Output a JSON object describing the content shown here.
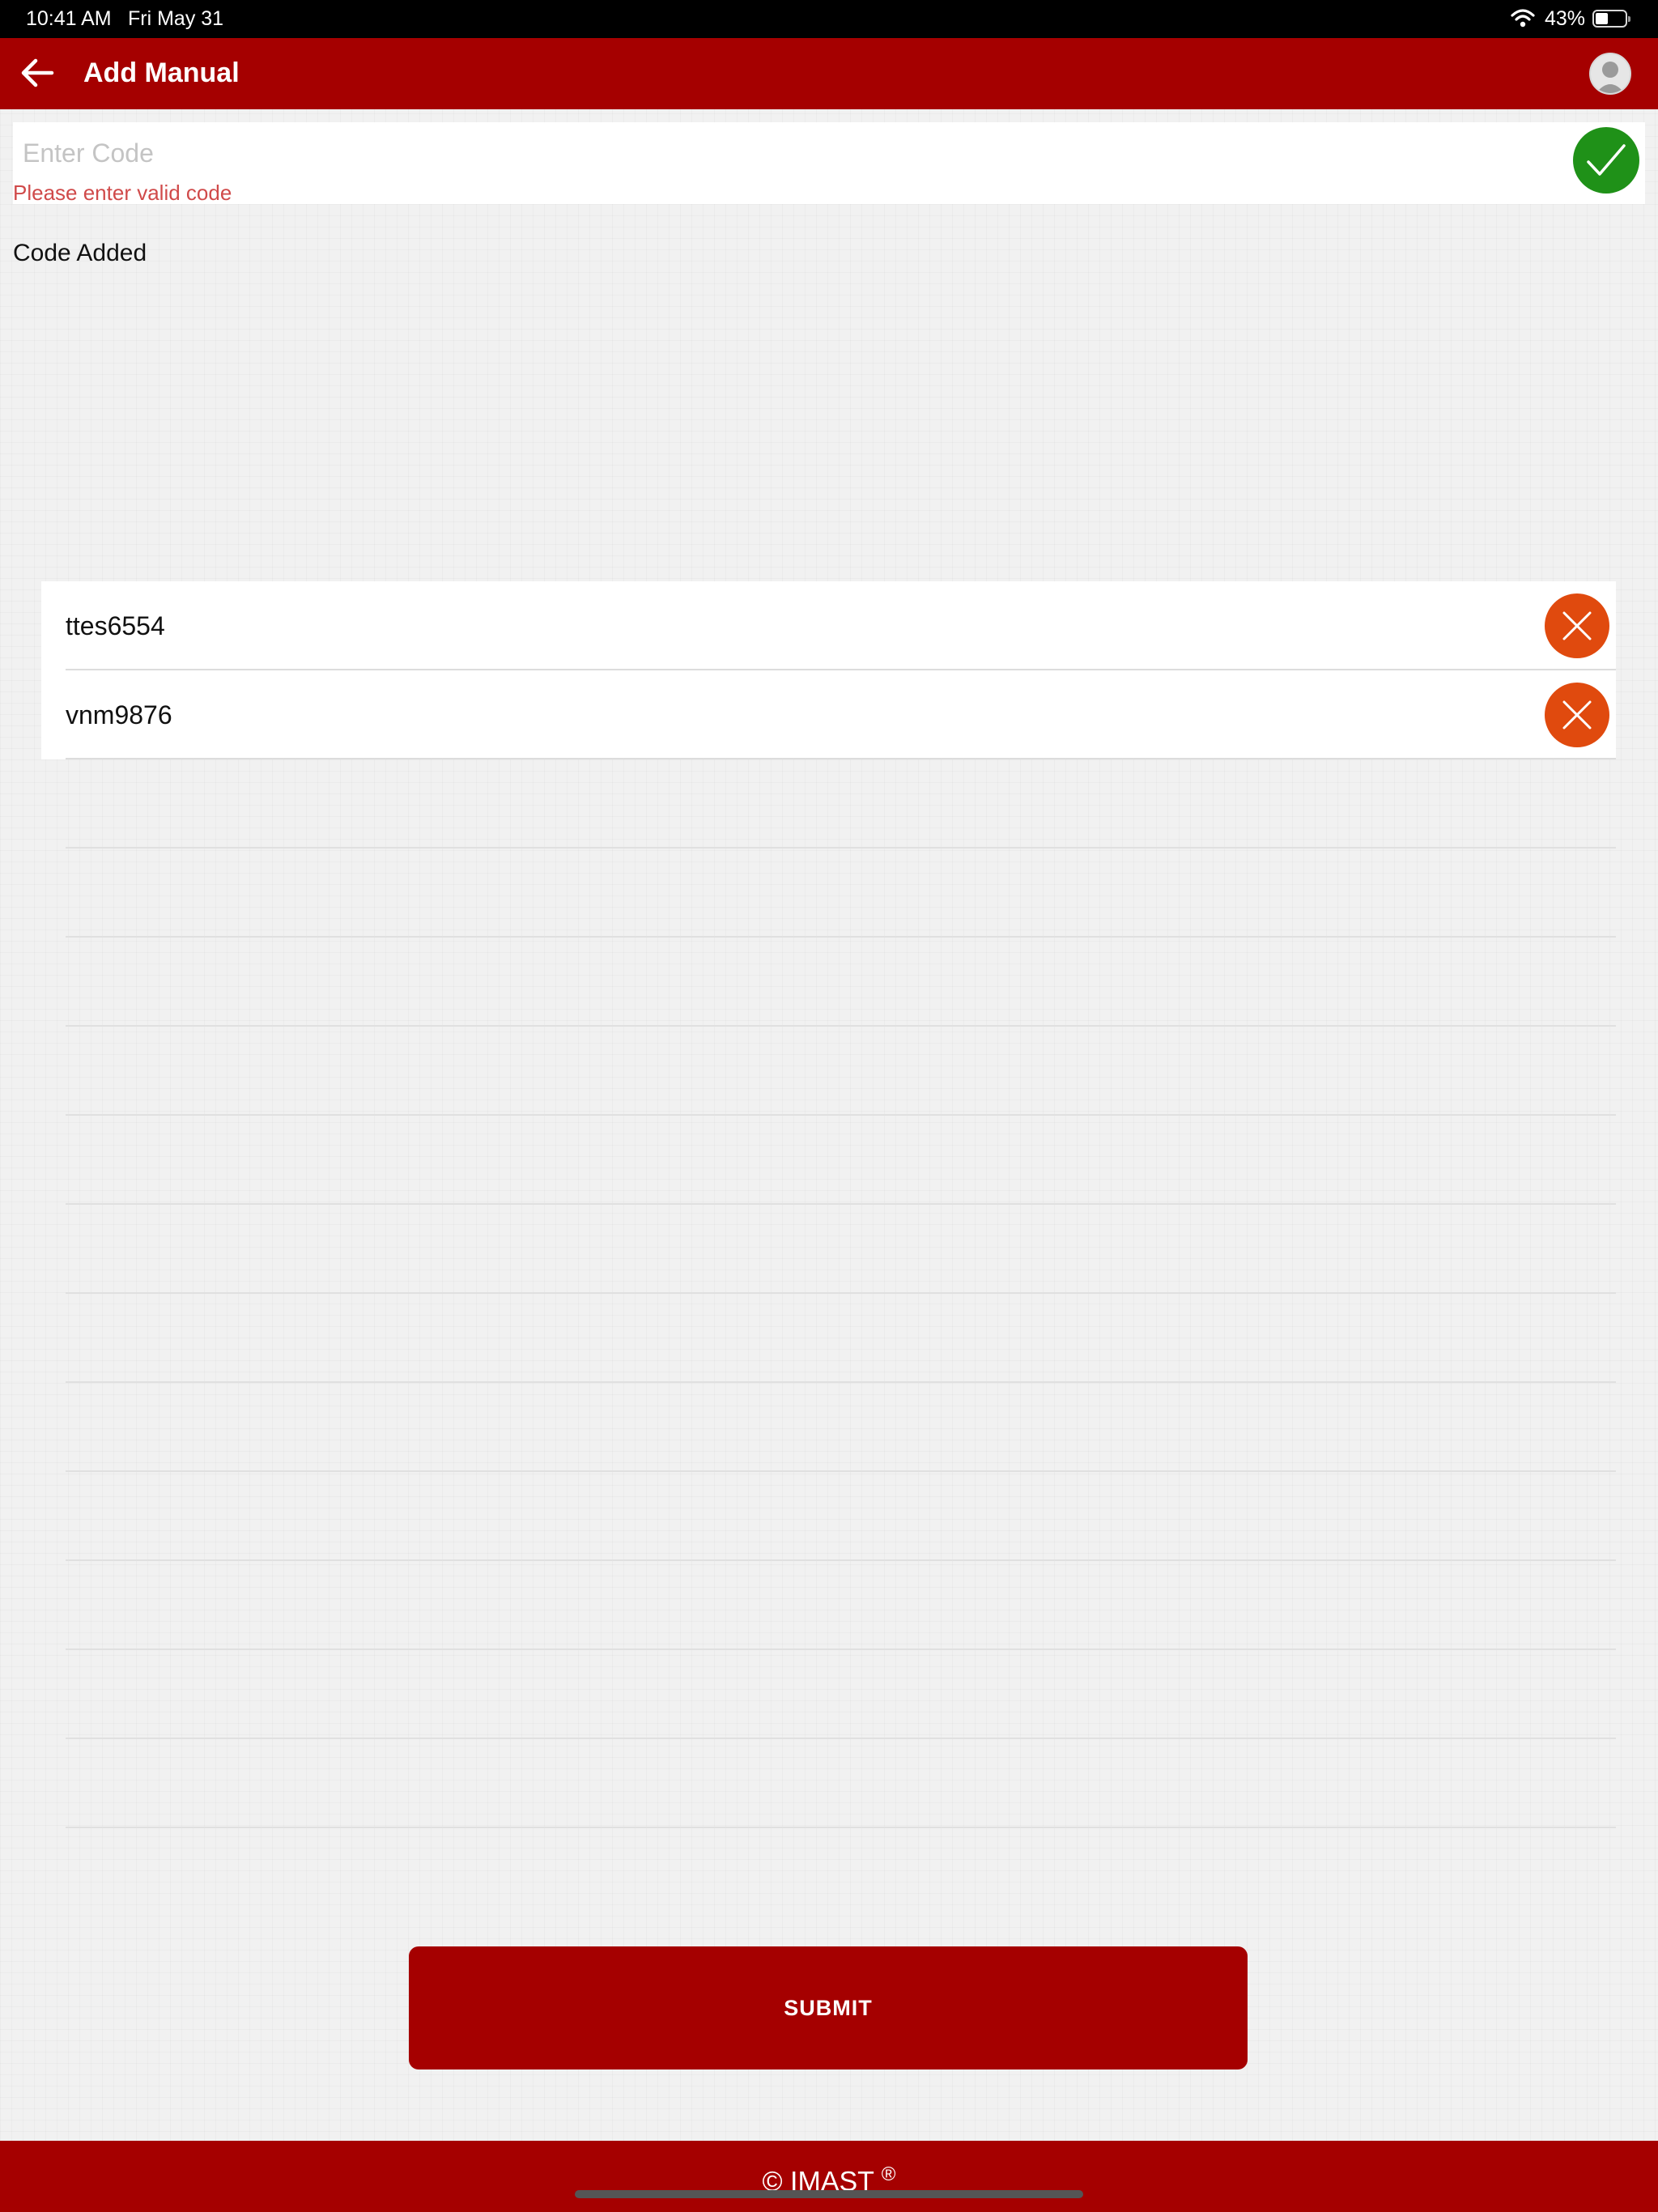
{
  "status_bar": {
    "time": "10:41 AM",
    "date": "Fri May 31",
    "battery_percent": "43%",
    "battery_level": 0.43,
    "wifi_icon": "wifi-icon",
    "battery_icon": "battery-icon"
  },
  "header": {
    "title": "Add Manual",
    "back_icon": "arrow-left-icon",
    "avatar_icon": "user-avatar-icon",
    "color": "#a50000"
  },
  "entry": {
    "placeholder": "Enter Code",
    "value": "",
    "error": "Please enter valid code",
    "confirm_icon": "checkmark-icon",
    "confirm_color": "#1f9118"
  },
  "codes_section": {
    "label": "Code Added",
    "remove_icon": "close-icon",
    "remove_color": "#e04a0e",
    "items": [
      {
        "code": "ttes6554"
      },
      {
        "code": "vnm9876"
      }
    ]
  },
  "submit": {
    "label": "SUBMIT"
  },
  "footer": {
    "brand": "IMAST",
    "copyright_symbol": "©",
    "registered_symbol": "®"
  }
}
